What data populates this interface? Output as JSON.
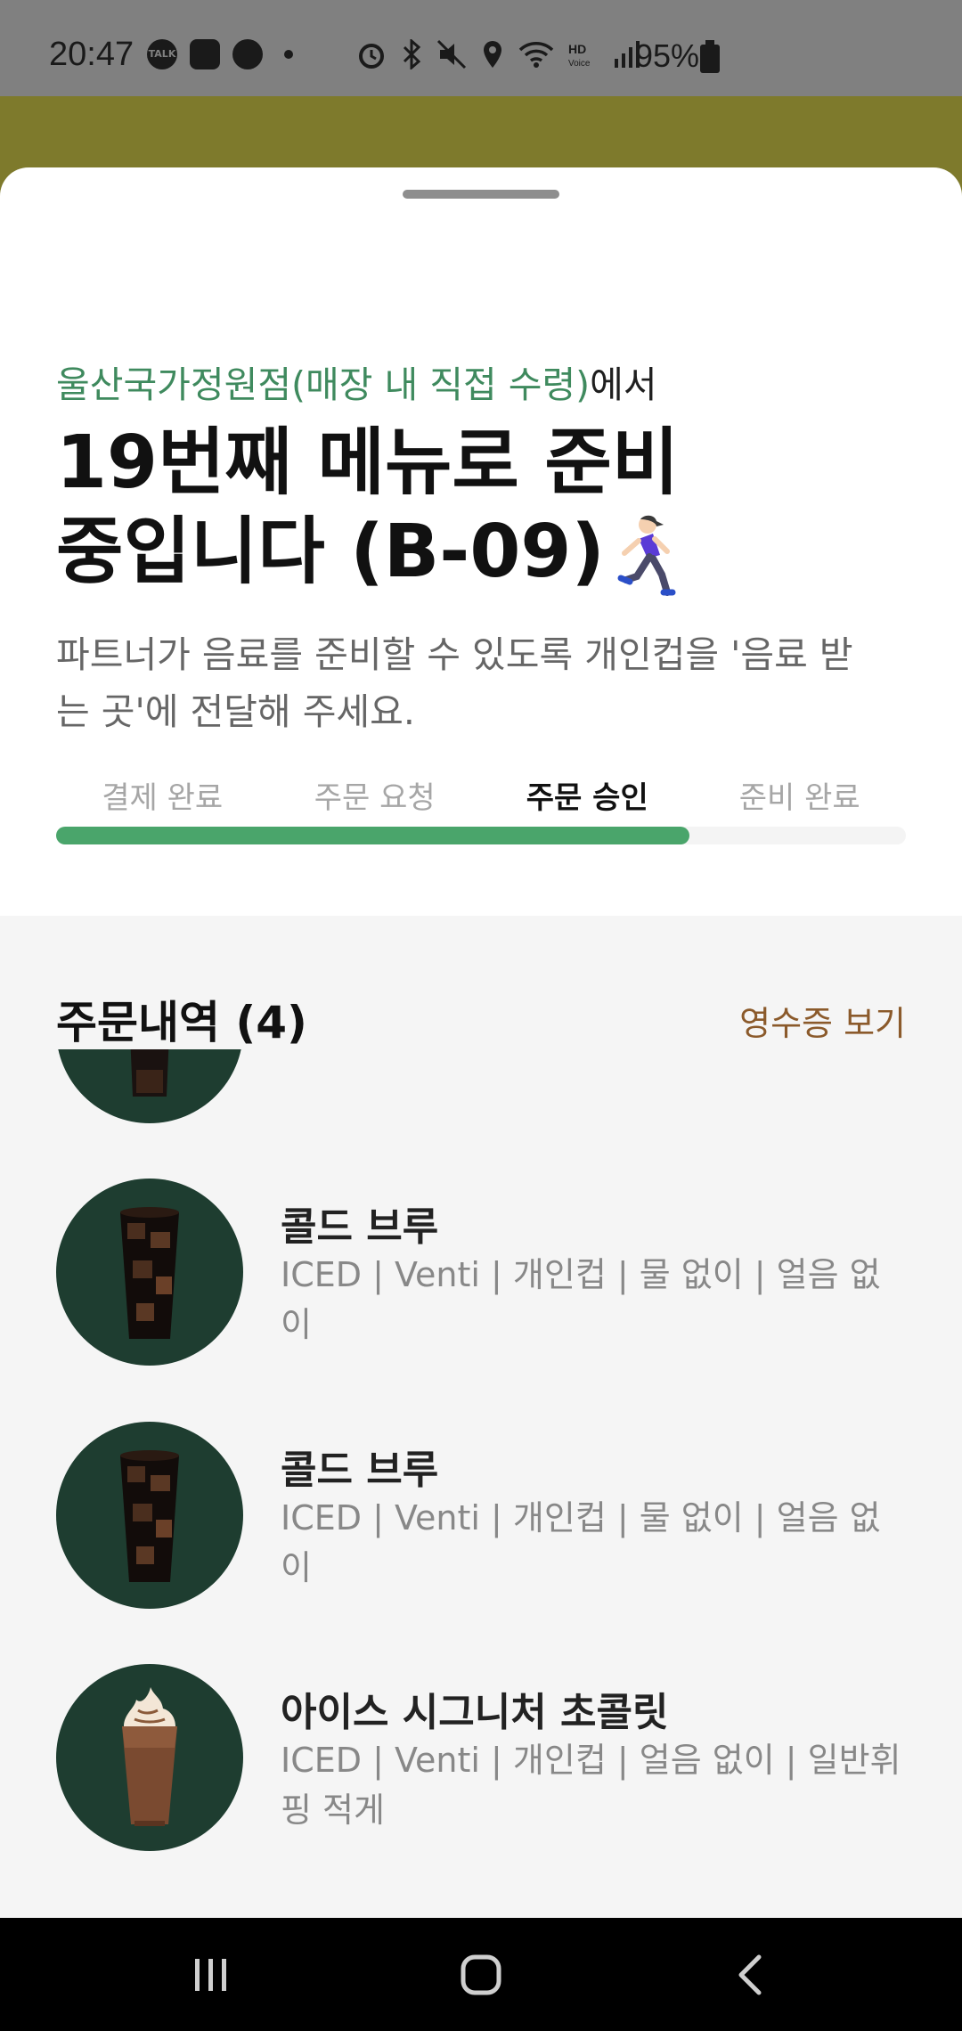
{
  "status_bar": {
    "time": "20:47",
    "left_icons": [
      "talk-icon",
      "person-icon",
      "starbucks-icon"
    ],
    "right_icons": [
      "alarm-icon",
      "bluetooth-icon",
      "mute-icon",
      "location-icon",
      "wifi-icon",
      "hd-voice-icon",
      "signal-icon"
    ],
    "battery": "95%"
  },
  "order_status": {
    "store_name": "울산국가정원점(매장 내 직접 수령)",
    "store_suffix": "에서",
    "headline_line1": "19번째 메뉴로 준비",
    "headline_line2": "중입니다 (B-09)",
    "description": "파트너가 음료를 준비할 수 있도록 개인컵을 '음료 받는 곳'에 전달해 주세요.",
    "steps": [
      "결제 완료",
      "주문 요청",
      "주문 승인",
      "준비 완료"
    ],
    "active_step_index": 2,
    "progress_fraction": 0.745
  },
  "orders": {
    "title": "주문내역 (4)",
    "receipt_label": "영수증 보기",
    "items": [
      {
        "name": "",
        "options": ""
      },
      {
        "name": "콜드 브루",
        "options": "ICED | Venti | 개인컵 | 물 없이 | 얼음 없이"
      },
      {
        "name": "콜드 브루",
        "options": "ICED | Venti | 개인컵 | 물 없이 | 얼음 없이"
      },
      {
        "name": "아이스 시그니처 초콜릿",
        "options": "ICED | Venti | 개인컵 | 얼음 없이 | 일반휘핑 적게"
      }
    ]
  },
  "colors": {
    "accent_green": "#4aa56b",
    "store_green": "#3f8a5e",
    "receipt_brown": "#8b5a2b",
    "thumb_bg": "#1e3d30"
  },
  "nav_bar": {
    "buttons": [
      "recent-apps-icon",
      "home-icon",
      "back-icon"
    ]
  }
}
